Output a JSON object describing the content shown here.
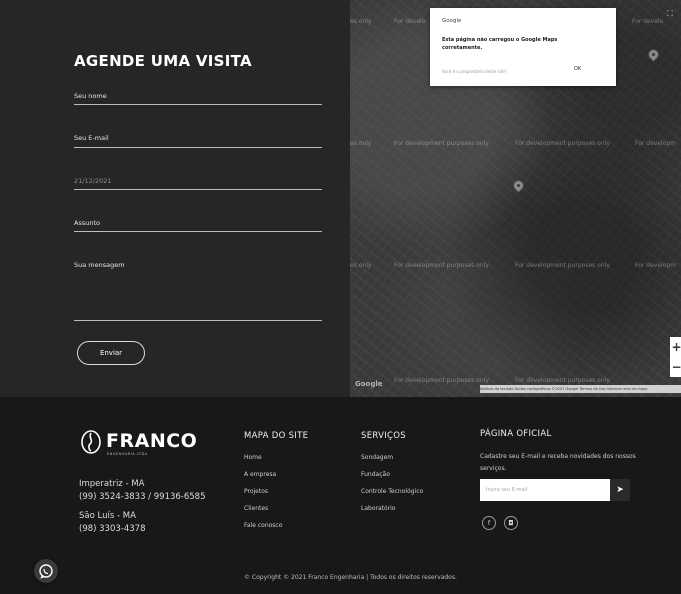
{
  "visit_form": {
    "title": "AGENDE UMA VISITA",
    "fields": {
      "name_label": "Seu nome",
      "email_label": "Seu E-mail",
      "date_value": "21/12/2021",
      "subject_label": "Assunto",
      "message_label": "Sua mensagem"
    },
    "submit_label": "Enviar"
  },
  "map": {
    "watermark": "For development purposes only",
    "watermark_short_only": "es only",
    "watermark_short_for": "For develo",
    "watermark_short_for2": "For developm",
    "dialog": {
      "title": "Google",
      "message": "Esta página não carregou o Google Maps corretamente.",
      "owner_line": "Você é o proprietário deste site?",
      "ok_label": "OK"
    },
    "fullscreen_symbol": "⛶",
    "zoom_in": "+",
    "zoom_out": "−",
    "google_logo": "Google",
    "attribution": "Atalhos do teclado   Dados cartográficos ©2021 Google   Termos de Uso   Informar erro no mapa"
  },
  "footer": {
    "logo_name": "FRANCO",
    "logo_tagline": "ENGENHARIA LTDA",
    "contacts": {
      "city1": "Imperatriz - MA",
      "phone1": "(99) 3524-3833 / 99136-6585",
      "city2": "São Luís - MA",
      "phone2": "(98) 3303-4378"
    },
    "sitemap": {
      "title": "MAPA DO SITE",
      "links": [
        "Home",
        "A empresa",
        "Projetos",
        "Clientes",
        "Fale conosco"
      ]
    },
    "services": {
      "title": "SERVIÇOS",
      "links": [
        "Sondagem",
        "Fundação",
        "Controle Tecnológico",
        "Laboratório"
      ]
    },
    "newsletter": {
      "title": "PÁGINA OFICIAL",
      "text": "Cadastre seu E-mail e receba novidades dos nossos serviços.",
      "placeholder": "Insira seu E-mail",
      "send_symbol": "➤"
    },
    "social": {
      "facebook": "f",
      "instagram": "◘"
    },
    "copyright": "© Copyright © 2021 Franco Engenharia | Todos os direitos reservados.",
    "whatsapp_symbol": "✆"
  }
}
